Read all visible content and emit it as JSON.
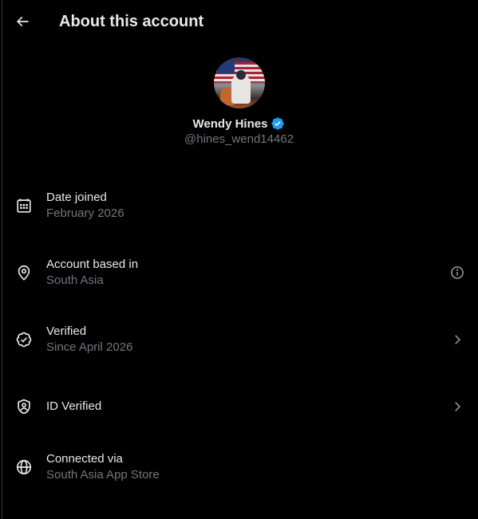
{
  "header": {
    "title": "About this account"
  },
  "profile": {
    "name": "Wendy Hines",
    "handle": "@hines_wend14462",
    "verified_color": "#1d9bf0"
  },
  "rows": [
    {
      "label": "Date joined",
      "sub": "February 2026",
      "icon": "calendar-icon",
      "trail": ""
    },
    {
      "label": "Account based in",
      "sub": "South Asia",
      "icon": "location-pin-icon",
      "trail": "info-icon"
    },
    {
      "label": "Verified",
      "sub": "Since April 2026",
      "icon": "verified-badge-outline-icon",
      "trail": "chevron-right-icon"
    },
    {
      "label": "ID Verified",
      "sub": "",
      "icon": "id-shield-icon",
      "trail": "chevron-right-icon"
    },
    {
      "label": "Connected via",
      "sub": "South Asia App Store",
      "icon": "globe-icon",
      "trail": ""
    }
  ],
  "colors": {
    "background": "#000000",
    "text": "#e7e9ea",
    "muted": "#71767b",
    "accent": "#1d9bf0"
  }
}
